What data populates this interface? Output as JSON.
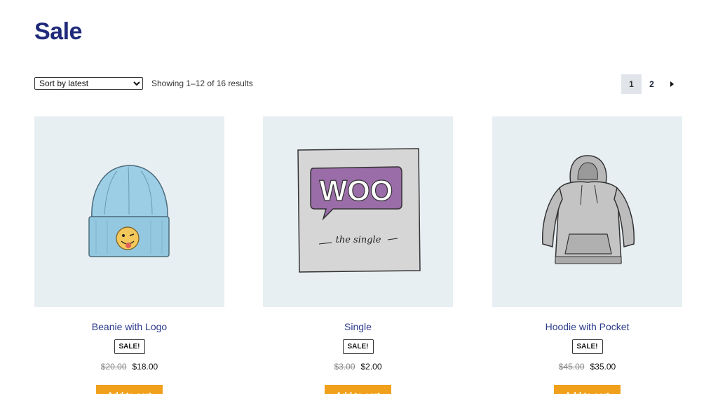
{
  "page": {
    "title": "Sale"
  },
  "toolbar": {
    "sort_selected": "Sort by latest",
    "result_count": "Showing 1–12 of 16 results"
  },
  "pagination": {
    "pages": [
      "1",
      "2"
    ],
    "current": "1",
    "next_icon": "chevron-right-icon"
  },
  "products": [
    {
      "name": "Beanie with Logo",
      "badge": "SALE!",
      "old_price": "$20.00",
      "price": "$18.00",
      "button_label": "Add to cart",
      "image": "beanie-with-logo-image"
    },
    {
      "name": "Single",
      "badge": "SALE!",
      "old_price": "$3.00",
      "price": "$2.00",
      "button_label": "Add to cart",
      "image": "woo-single-album-image",
      "image_text": "WOO",
      "image_subtext": "the single"
    },
    {
      "name": "Hoodie with Pocket",
      "badge": "SALE!",
      "old_price": "$45.00",
      "price": "$35.00",
      "button_label": "Add to cart",
      "image": "hoodie-with-pocket-image"
    }
  ],
  "colors": {
    "title": "#1f2a7a",
    "link": "#2b3a8c",
    "button": "#f0a01a",
    "image_bg": "#e8eff3"
  }
}
